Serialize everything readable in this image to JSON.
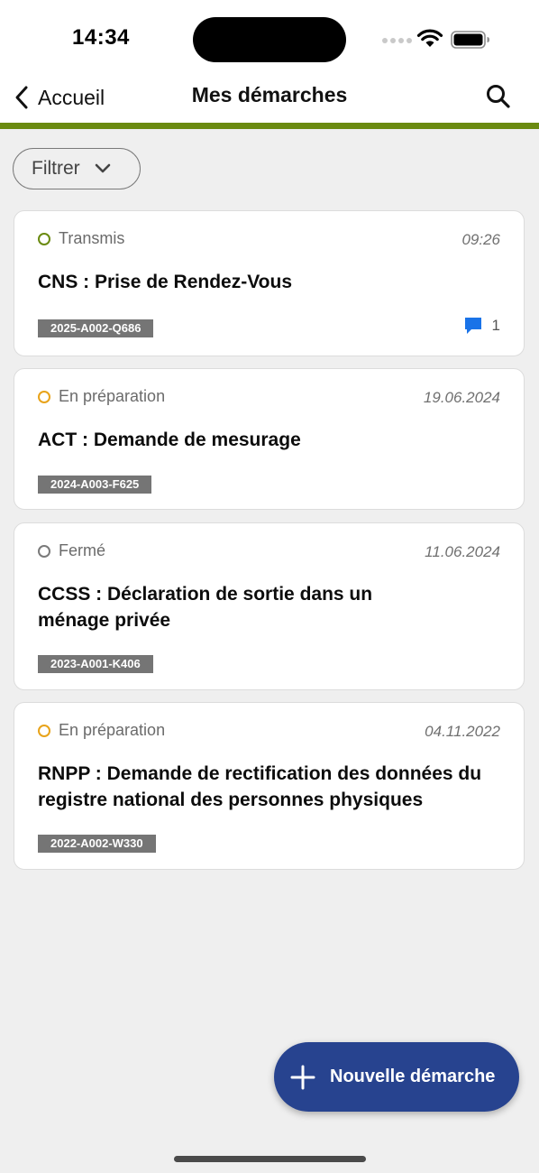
{
  "status_bar": {
    "time": "14:34"
  },
  "nav": {
    "back_label": "Accueil",
    "title": "Mes démarches"
  },
  "filter": {
    "label": "Filtrer"
  },
  "colors": {
    "accent": "#6a8a10",
    "primary": "#27438f",
    "status_transmis": "#6a8a10",
    "status_preparation": "#e8a31a",
    "status_ferme": "#7a7a7a",
    "message_icon": "#1a73e8"
  },
  "cards": [
    {
      "status": "Transmis",
      "status_icon": "circle-outline-green",
      "date": "09:26",
      "title": "CNS : Prise de Rendez-Vous",
      "reference": "2025-A002-Q686",
      "messages": "1",
      "message_icon": "chat-bubble-icon"
    },
    {
      "status": "En préparation",
      "status_icon": "circle-outline-orange",
      "date": "19.06.2024",
      "title": "ACT : Demande de mesurage",
      "reference": "2024-A003-F625"
    },
    {
      "status": "Fermé",
      "status_icon": "circle-outline-gray",
      "date": "11.06.2024",
      "title": "CCSS : Déclaration de sortie dans un ménage privée",
      "reference": "2023-A001-K406"
    },
    {
      "status": "En préparation",
      "status_icon": "circle-outline-orange",
      "date": "04.11.2022",
      "title": "RNPP : Demande de rectification des données du registre national des personnes physiques",
      "reference": "2022-A002-W330"
    }
  ],
  "fab": {
    "label": "Nouvelle démarche",
    "icon": "plus-icon"
  }
}
